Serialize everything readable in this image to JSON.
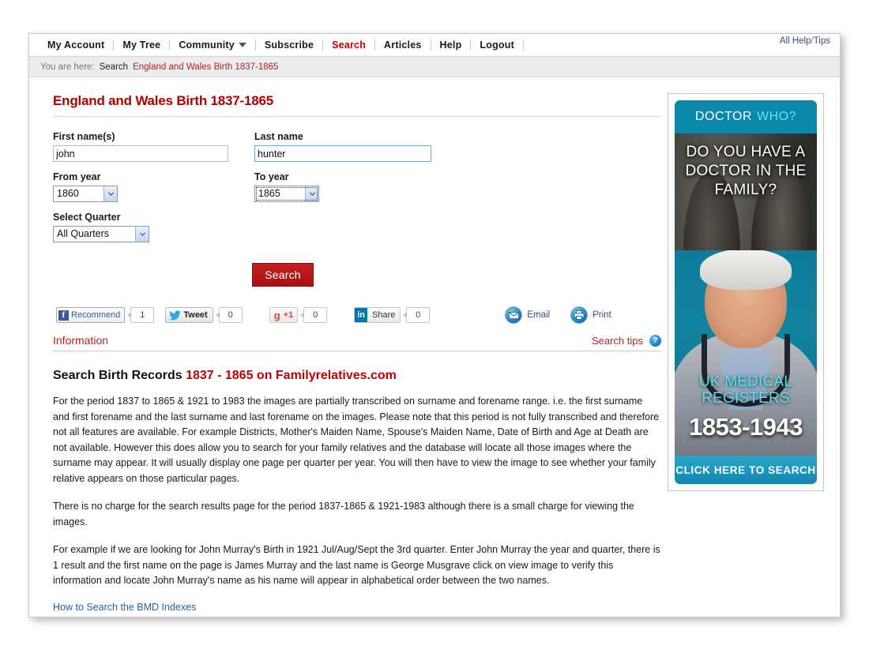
{
  "nav": {
    "items": [
      {
        "label": "My Account",
        "active": false
      },
      {
        "label": "My Tree",
        "active": false
      },
      {
        "label": "Community",
        "active": false,
        "has_caret": true
      },
      {
        "label": "Subscribe",
        "active": false
      },
      {
        "label": "Search",
        "active": true
      },
      {
        "label": "Articles",
        "active": false
      },
      {
        "label": "Help",
        "active": false
      },
      {
        "label": "Logout",
        "active": false
      }
    ],
    "all_help": "All Help",
    "separator": "/",
    "tips": "Tips"
  },
  "breadcrumb": {
    "prefix": "You are here:",
    "node": "Search",
    "current": "England and Wales Birth 1837-1865"
  },
  "page": {
    "title": "England and Wales Birth 1837-1865"
  },
  "form": {
    "first_name_label": "First name(s)",
    "first_name_value": "john",
    "last_name_label": "Last name",
    "last_name_value": "hunter",
    "from_year_label": "From year",
    "from_year_value": "1860",
    "to_year_label": "To year",
    "to_year_value": "1865",
    "quarter_label": "Select Quarter",
    "quarter_value": "All Quarters",
    "search_button": "Search"
  },
  "social": {
    "facebook_label": "Recommend",
    "facebook_glyph": "f",
    "facebook_count": "1",
    "twitter_label": "Tweet",
    "twitter_count": "0",
    "google_label": "+1",
    "google_glyph": "g",
    "google_count": "0",
    "linkedin_glyph": "in",
    "linkedin_label": "Share",
    "linkedin_count": "0",
    "email_label": "Email",
    "print_label": "Print"
  },
  "information": {
    "section_title": "Information",
    "search_tips": "Search tips",
    "help_glyph": "?",
    "heading_black": "Search Birth Records",
    "heading_red": "1837 - 1865 on Familyrelatives.com",
    "paragraphs": [
      "For the period 1837 to 1865 & 1921 to 1983 the images are partially transcribed on surname and forename range. i.e. the first surname and first forename and the last surname and last forename on the images. Please note that this period is not fully transcribed and therefore not all features are available. For example Districts, Mother's Maiden Name, Spouse's Maiden Name, Date of Birth and Age at Death are not available. However this does allow you to search for your family relatives and the database will locate all those images where the surname may appear. It will usually display one page per quarter per year. You will then have to view the image to see whether your family relative appears on those particular pages.",
      "There is no charge for the search results page for the period 1837-1865 & 1921-1983 although there is a small charge for viewing the images.",
      "For example if we are looking for John Murray's Birth in 1921 Jul/Aug/Sept the 3rd quarter. Enter John Murray the year and quarter, there is 1 result and the first name on the page is James Murray and the last name is George Musgrave click on view image to verify this information and locate John Murray's name as his name will appear in alphabetical order between the two names."
    ],
    "bmd_link": "How to Search the BMD Indexes"
  },
  "advert": {
    "top_line_1": "DOCTOR",
    "top_line_2": "WHO?",
    "headline": "DO YOU HAVE A DOCTOR IN THE FAMILY?",
    "registers": "UK MEDICAL REGISTERS",
    "years": "1853-1943",
    "cta": "CLICK HERE TO SEARCH"
  },
  "colors": {
    "brand_red": "#b22222",
    "title_red": "#b00000",
    "link_blue": "#2a5d9e",
    "ad_teal": "#0d88ab",
    "ad_cyan": "#4fe3f2",
    "search_btn_red": "#c31f1f"
  }
}
